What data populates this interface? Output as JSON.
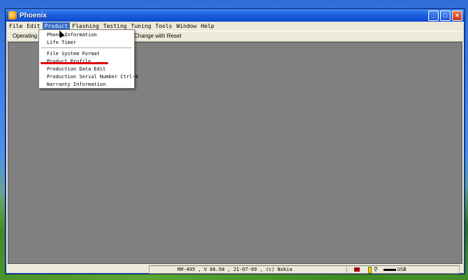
{
  "window": {
    "title": "Phoenix"
  },
  "title_buttons": {
    "minimize": "_",
    "maximize": "□",
    "close": "×"
  },
  "menubar": {
    "items": [
      {
        "label": "File"
      },
      {
        "label": "Edit"
      },
      {
        "label": "Product"
      },
      {
        "label": "Flashing"
      },
      {
        "label": "Testing"
      },
      {
        "label": "Tuning"
      },
      {
        "label": "Tools"
      },
      {
        "label": "Window"
      },
      {
        "label": "Help"
      }
    ]
  },
  "toolbar": {
    "left_text": "Operating m",
    "right_text": "Change with Reset"
  },
  "product_menu": {
    "items": [
      {
        "label": "Phone Information"
      },
      {
        "label": "Life Timer"
      },
      {
        "label": "File System Format"
      },
      {
        "label": "Product Profile"
      },
      {
        "label": "Production Data Edit"
      },
      {
        "label": "Production Serial Number Ctrl-N"
      },
      {
        "label": "Warranty Information"
      }
    ]
  },
  "statusbar": {
    "info": "RM-495 , V 06.94 , 21-07-09 , (c) Nokia",
    "connection": "USB"
  },
  "colors": {
    "highlight": "#316ac5",
    "annotation": "#e00000"
  }
}
